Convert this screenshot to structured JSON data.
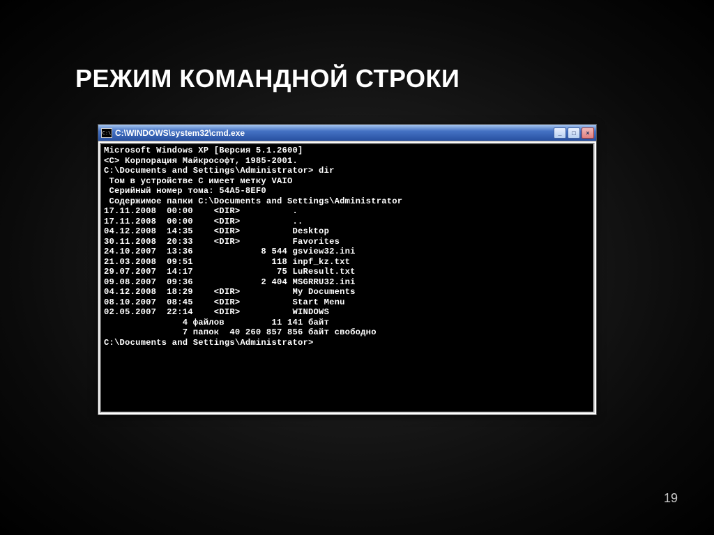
{
  "slide": {
    "title": "РЕЖИМ КОМАНДНОЙ СТРОКИ",
    "page_number": "19"
  },
  "window": {
    "title_icon": "C:\\",
    "title": "C:\\WINDOWS\\system32\\cmd.exe",
    "buttons": {
      "minimize": "_",
      "maximize": "□",
      "close": "×"
    }
  },
  "terminal": {
    "lines": [
      "Microsoft Windows XP [Версия 5.1.2600]",
      "<C> Корпорация Майкрософт, 1985-2001.",
      "",
      "C:\\Documents and Settings\\Administrator> dir",
      " Том в устройстве C имеет метку VAIO",
      " Серийный номер тома: 54A5-8EF0",
      "",
      " Содержимое папки C:\\Documents and Settings\\Administrator",
      "",
      "17.11.2008  00:00    <DIR>          .",
      "17.11.2008  00:00    <DIR>          ..",
      "04.12.2008  14:35    <DIR>          Desktop",
      "30.11.2008  20:33    <DIR>          Favorites",
      "24.10.2007  13:36             8 544 gsview32.ini",
      "21.03.2008  09:51               118 inpf_kz.txt",
      "29.07.2007  14:17                75 LuResult.txt",
      "09.08.2007  09:36             2 404 MSGRRU32.ini",
      "04.12.2008  18:29    <DIR>          My Documents",
      "08.10.2007  08:45    <DIR>          Start Menu",
      "02.05.2007  22:14    <DIR>          WINDOWS",
      "               4 файлов         11 141 байт",
      "               7 папок  40 260 857 856 байт свободно",
      "",
      "C:\\Documents and Settings\\Administrator>",
      ""
    ]
  }
}
